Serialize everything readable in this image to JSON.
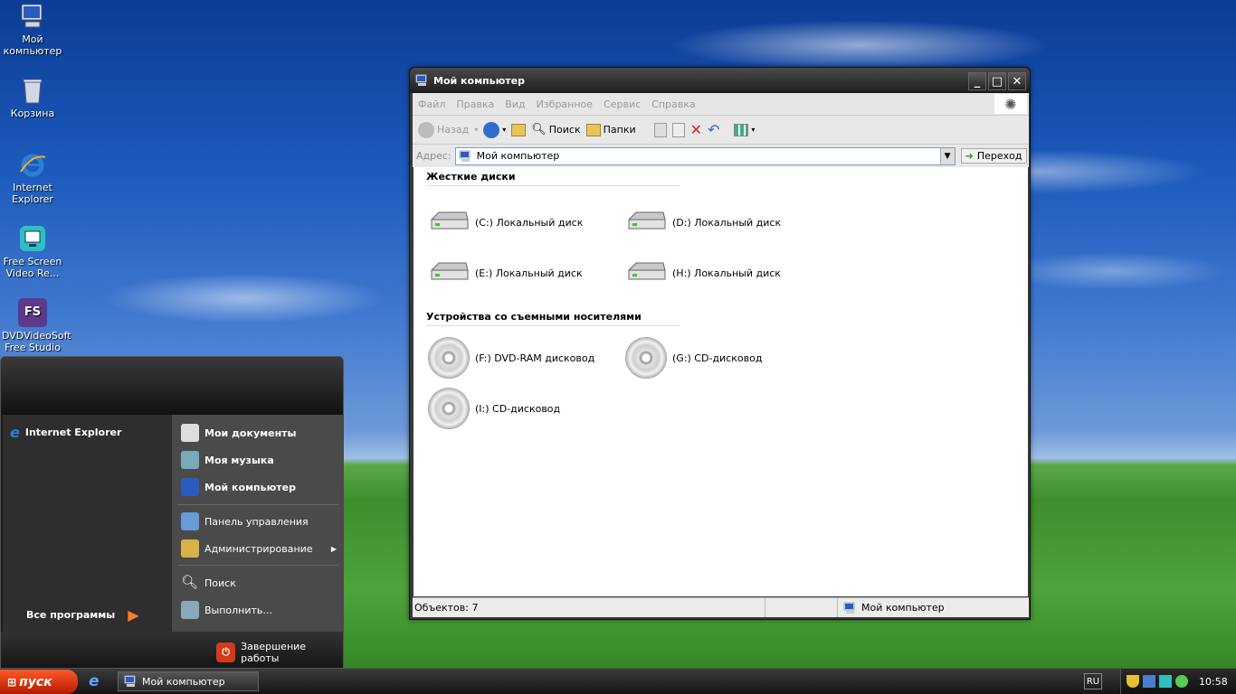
{
  "desktop": {
    "icons": [
      {
        "label": "Мой\nкомпьютер",
        "icon": "computer-icon"
      },
      {
        "label": "Корзина",
        "icon": "recycle-bin-icon"
      },
      {
        "label": "Internet\nExplorer",
        "icon": "ie-icon"
      },
      {
        "label": "Free Screen\nVideo Re...",
        "icon": "screen-recorder-icon"
      },
      {
        "label": "DVDVideoSoft\nFree Studio",
        "icon": "fs-icon",
        "badge": "FS"
      }
    ]
  },
  "window": {
    "title": "Мой компьютер",
    "controls": {
      "minimize": "_",
      "maximize": "□",
      "close": "✕"
    },
    "menu": [
      "Файл",
      "Правка",
      "Вид",
      "Избранное",
      "Сервис",
      "Справка"
    ],
    "toolbar": {
      "back": "Назад",
      "search": "Поиск",
      "folders": "Папки"
    },
    "address": {
      "label": "Адрес:",
      "value": "Мой компьютер",
      "go": "Переход"
    },
    "sections": [
      {
        "title": "Жесткие диски",
        "items": [
          "(C:) Локальный диск",
          "(D:) Локальный диск",
          "(E:) Локальный диск",
          "(H:) Локальный диск"
        ]
      },
      {
        "title": "Устройства со съемными носителями",
        "items": [
          "(F:) DVD-RAM дисковод",
          "(G:) CD-дисковод",
          "(I:) CD-дисковод"
        ]
      }
    ],
    "status": {
      "objects": "Объектов: 7",
      "location": "Мой компьютер"
    }
  },
  "start_menu": {
    "pinned": "Internet Explorer",
    "all_programs": "Все программы",
    "right": [
      "Мои документы",
      "Моя музыка",
      "Мой компьютер",
      "Панель управления",
      "Администрирование",
      "Поиск",
      "Выполнить..."
    ],
    "shutdown": "Завершение работы"
  },
  "taskbar": {
    "start": "пуск",
    "task": "Мой компьютер",
    "lang": "RU",
    "clock": "10:58"
  },
  "colors": {
    "accent": "#ff5a2a",
    "window_dark": "#2a2a2a"
  }
}
